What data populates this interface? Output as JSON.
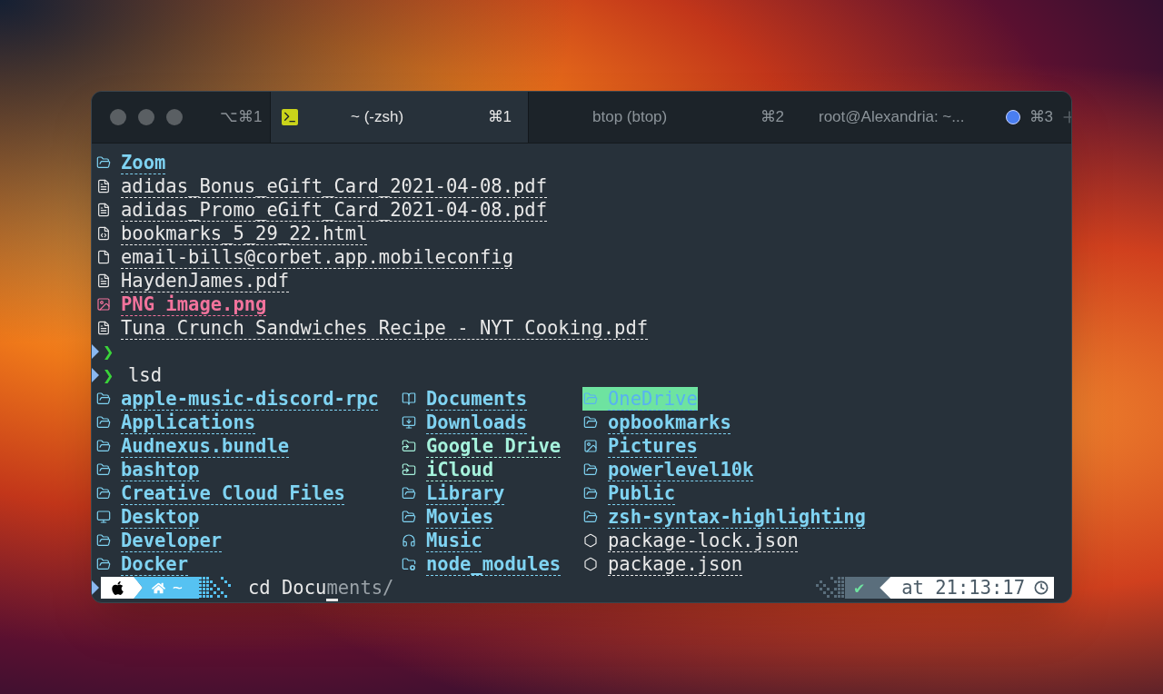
{
  "titlebar": {
    "window_shortcut": "⌥⌘1"
  },
  "tabs": [
    {
      "title": "~ (-zsh)",
      "shortcut": "⌘1",
      "selected": true,
      "activity": false
    },
    {
      "title": "btop (btop)",
      "shortcut": "⌘2",
      "selected": false,
      "activity": false
    },
    {
      "title": "root@Alexandria: ~...",
      "shortcut": "⌘3",
      "selected": false,
      "activity": true
    }
  ],
  "earlier_listing": [
    {
      "name": "Zoom",
      "kind": "folder",
      "color": "#7fd3f2",
      "bold": true
    },
    {
      "name": "adidas_Bonus_eGift_Card_2021-04-08.pdf",
      "kind": "pdf",
      "color": "#e8e8e8",
      "bold": false
    },
    {
      "name": "adidas_Promo_eGift_Card_2021-04-08.pdf",
      "kind": "pdf",
      "color": "#e8e8e8",
      "bold": false
    },
    {
      "name": "bookmarks_5_29_22.html",
      "kind": "html",
      "color": "#e8e8e8",
      "bold": false
    },
    {
      "name": "email-bills@corbet.app.mobileconfig",
      "kind": "file",
      "color": "#e8e8e8",
      "bold": false
    },
    {
      "name": "HaydenJames.pdf",
      "kind": "pdf",
      "color": "#e8e8e8",
      "bold": false
    },
    {
      "name": "PNG image.png",
      "kind": "image",
      "color": "#f2739c",
      "bold": true
    },
    {
      "name": "Tuna Crunch Sandwiches Recipe - NYT Cooking.pdf",
      "kind": "pdf",
      "color": "#e8e8e8",
      "bold": false
    }
  ],
  "prompts": [
    {
      "char": "❯"
    },
    {
      "char": "❯",
      "command": "lsd"
    }
  ],
  "lsd_columns": [
    [
      {
        "name": "apple-music-discord-rpc",
        "kind": "folder",
        "color": "#7fd3f2",
        "bold": true,
        "highlighted": false
      },
      {
        "name": "Applications",
        "kind": "folder",
        "color": "#7fd3f2",
        "bold": true,
        "highlighted": false
      },
      {
        "name": "Audnexus.bundle",
        "kind": "folder",
        "color": "#7fd3f2",
        "bold": true,
        "highlighted": false
      },
      {
        "name": "bashtop",
        "kind": "folder",
        "color": "#7fd3f2",
        "bold": true,
        "highlighted": false
      },
      {
        "name": "Creative Cloud Files",
        "kind": "folder",
        "color": "#7fd3f2",
        "bold": true,
        "highlighted": false
      },
      {
        "name": "Desktop",
        "kind": "desktop",
        "color": "#7fd3f2",
        "bold": true,
        "highlighted": false
      },
      {
        "name": "Developer",
        "kind": "folder",
        "color": "#7fd3f2",
        "bold": true,
        "highlighted": false
      },
      {
        "name": "Docker",
        "kind": "folder",
        "color": "#7fd3f2",
        "bold": true,
        "highlighted": false
      }
    ],
    [
      {
        "name": "Documents",
        "kind": "book",
        "color": "#7fd3f2",
        "bold": true,
        "highlighted": false
      },
      {
        "name": "Downloads",
        "kind": "download",
        "color": "#7fd3f2",
        "bold": true,
        "highlighted": false
      },
      {
        "name": "Google Drive",
        "kind": "symlink",
        "color": "#a6f2dc",
        "bold": true,
        "highlighted": false
      },
      {
        "name": "iCloud",
        "kind": "symlink",
        "color": "#a6f2dc",
        "bold": true,
        "highlighted": false
      },
      {
        "name": "Library",
        "kind": "folder",
        "color": "#7fd3f2",
        "bold": true,
        "highlighted": false
      },
      {
        "name": "Movies",
        "kind": "folder",
        "color": "#7fd3f2",
        "bold": true,
        "highlighted": false
      },
      {
        "name": "Music",
        "kind": "headphones",
        "color": "#7fd3f2",
        "bold": true,
        "highlighted": false
      },
      {
        "name": "node_modules",
        "kind": "node",
        "color": "#7fd3f2",
        "bold": true,
        "highlighted": false
      }
    ],
    [
      {
        "name": "OneDrive",
        "kind": "folder",
        "bold": false,
        "highlighted": true
      },
      {
        "name": "opbookmarks",
        "kind": "folder",
        "color": "#7fd3f2",
        "bold": true,
        "highlighted": false
      },
      {
        "name": "Pictures",
        "kind": "picture",
        "color": "#7fd3f2",
        "bold": true,
        "highlighted": false
      },
      {
        "name": "powerlevel10k",
        "kind": "folder",
        "color": "#7fd3f2",
        "bold": true,
        "highlighted": false
      },
      {
        "name": "Public",
        "kind": "folder",
        "color": "#7fd3f2",
        "bold": true,
        "highlighted": false
      },
      {
        "name": "zsh-syntax-highlighting",
        "kind": "folder",
        "color": "#7fd3f2",
        "bold": true,
        "highlighted": false
      },
      {
        "name": "package-lock.json",
        "kind": "js",
        "color": "#e8e8e8",
        "bold": false,
        "highlighted": false
      },
      {
        "name": "package.json",
        "kind": "js",
        "color": "#e8e8e8",
        "bold": false,
        "highlighted": false
      }
    ]
  ],
  "current_prompt": {
    "directory": "~",
    "typed": "cd Docu",
    "suggestion": "ments/",
    "status": "✔",
    "time": "at 21:13:17"
  }
}
